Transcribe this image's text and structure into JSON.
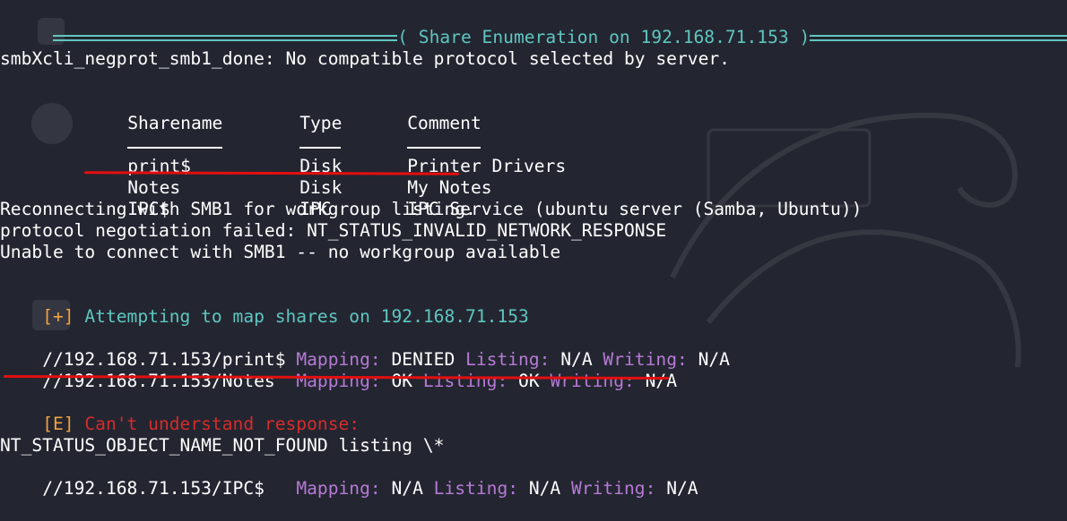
{
  "header": {
    "prefix": "( ",
    "title": "Share Enumeration on 192.168.71.153",
    "suffix": " )"
  },
  "output": {
    "negprot": "smbXcli_negprot_smb1_done: No compatible protocol selected by server.",
    "share_table": {
      "headers": [
        "Sharename",
        "Type",
        "Comment"
      ],
      "rows": [
        [
          "print$",
          "Disk",
          "Printer Drivers"
        ],
        [
          "Notes",
          "Disk",
          "My Notes"
        ],
        [
          "IPC$",
          "IPC",
          "IPC Service (ubuntu server (Samba, Ubuntu))"
        ]
      ]
    },
    "reconnect": "Reconnecting with SMB1 for workgroup listing.",
    "negotiation_failed": "protocol negotiation failed: NT_STATUS_INVALID_NETWORK_RESPONSE",
    "unable": "Unable to connect with SMB1 -- no workgroup available",
    "attempt_tag": "[+]",
    "attempt_text": " Attempting to map shares on 192.168.71.153",
    "mappings": [
      {
        "path": "//192.168.71.153/print$",
        "pad": " ",
        "mapping_label": "Mapping:",
        "mapping": "DENIED",
        "listing_label": "Listing:",
        "listing": "N/A",
        "writing_label": "Writing:",
        "writing": "N/A"
      },
      {
        "path": "//192.168.71.153/Notes",
        "pad": "  ",
        "mapping_label": "Mapping:",
        "mapping": "OK",
        "listing_label": "Listing:",
        "listing": "OK",
        "writing_label": "Writing:",
        "writing": "N/A"
      },
      {
        "path": "//192.168.71.153/IPC$",
        "pad": "   ",
        "mapping_label": "Mapping:",
        "mapping": "N/A",
        "listing_label": "Listing:",
        "listing": "N/A",
        "writing_label": "Writing:",
        "writing": "N/A"
      }
    ],
    "error_tag": "[E]",
    "error_text": " Can't understand response:",
    "not_found": "NT_STATUS_OBJECT_NAME_NOT_FOUND listing \\*"
  },
  "colors": {
    "background": "#232631",
    "teal": "#5fc6c0",
    "orange": "#f3a13c",
    "red": "#d62b2b",
    "purple": "#b77ad6",
    "annotation_red": "#e30f0f"
  },
  "icons": [
    "kali-dragon-watermark-icon",
    "wireshark-desktop-icon",
    "terminal-desktop-icon",
    "home-desktop-icon"
  ]
}
